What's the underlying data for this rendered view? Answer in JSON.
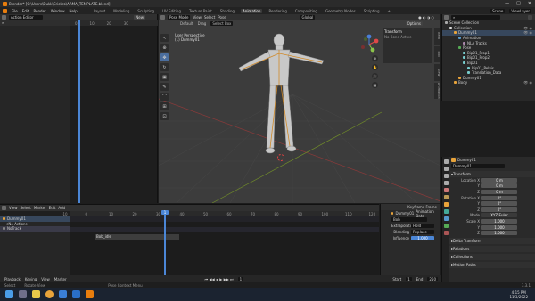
{
  "window": {
    "title": "Blender* [C:\\Users\\Dukk\\Erickro\\ARMA_TEMPLATE.blend]",
    "controls": [
      "—",
      "□",
      "✕"
    ]
  },
  "menubar": {
    "menus": [
      "File",
      "Edit",
      "Render",
      "Window",
      "Help"
    ],
    "workspaces": [
      "Layout",
      "Modeling",
      "Sculpting",
      "UV Editing",
      "Texture Paint",
      "Shading",
      "Animation",
      "Rendering",
      "Compositing",
      "Geometry Nodes",
      "Scripting",
      "+"
    ],
    "active_workspace": "Animation",
    "scene": "Scene",
    "view_layer": "ViewLayer"
  },
  "action_editor": {
    "mode": "Action Editor",
    "new_button": "New",
    "ruler": [
      "0",
      "10",
      "20",
      "30"
    ]
  },
  "viewport": {
    "mode": "Pose Mode",
    "menus": [
      "View",
      "Select",
      "Pose"
    ],
    "orientation": "Global",
    "orientation_default": "Default",
    "drag": "Drag",
    "select_box": "Select Box",
    "options": "Options",
    "info_line1": "User Perspective",
    "info_line2": "(1) Dummy01",
    "tool_icons": [
      "↖",
      "⊕",
      "✥",
      "↻",
      "▣",
      "✎",
      "⌒",
      "⊞",
      "⊡"
    ],
    "n_panel_title": "Transform",
    "n_panel_text": "No Bone Active",
    "side_tabs": [
      "Item",
      "Tool",
      "View",
      "Animation"
    ],
    "gizmo_axes": [
      "X",
      "Y",
      "Z"
    ],
    "nav_buttons": [
      "⊕",
      "✋",
      "🎥",
      "▦"
    ]
  },
  "outliner": {
    "search": "",
    "rows": [
      {
        "label": "Scene Collection",
        "indent": 0
      },
      {
        "label": "Collection",
        "indent": 1
      },
      {
        "label": "Dummy01",
        "indent": 2,
        "selected": true
      },
      {
        "label": "Animation",
        "indent": 3
      },
      {
        "label": "NLA Tracks",
        "indent": 4
      },
      {
        "label": "Pose",
        "indent": 3
      },
      {
        "label": "Bip01_Prop1",
        "indent": 4
      },
      {
        "label": "Bip01_Prop2",
        "indent": 4
      },
      {
        "label": "Bip01",
        "indent": 4
      },
      {
        "label": "Bip01_Pelvis",
        "indent": 5
      },
      {
        "label": "Translation_Data",
        "indent": 5
      },
      {
        "label": "Dummy01",
        "indent": 3
      },
      {
        "label": "Body",
        "indent": 2
      }
    ]
  },
  "properties": {
    "object_name": "Dummy01",
    "data_name": "Dummy01",
    "transform_title": "Transform",
    "location": {
      "label": "Location X",
      "x": "0 m",
      "y": "0 m",
      "z": "0 m"
    },
    "rotation": {
      "label": "Rotation X",
      "x": "0°",
      "y": "0°",
      "z": "0°"
    },
    "mode_label": "Mode",
    "mode": "XYZ Euler",
    "scale": {
      "label": "Scale X",
      "x": "1.000",
      "y": "1.000",
      "z": "1.000"
    },
    "sections": [
      "Delta Transform",
      "Relations",
      "Collections",
      "Motion Paths"
    ]
  },
  "timeline": {
    "menus": [
      "View",
      "Select",
      "Marker",
      "Edit",
      "Add"
    ],
    "ruler": [
      "-10",
      "0",
      "10",
      "20",
      "30",
      "40",
      "50",
      "60",
      "70",
      "80",
      "90",
      "100",
      "110",
      "120"
    ],
    "channels": [
      "Dummy01",
      "<No Action>",
      "NoTrack"
    ],
    "strip_label": "Bob_idle",
    "playhead_frame": "1"
  },
  "strip_props": {
    "title": "Dummy01",
    "subtitle": "Animation Data",
    "action_label": "Bob",
    "extrapolation_label": "Extrapolation",
    "extrapolation": "Hold",
    "blending_label": "Blending",
    "blending": "Replace",
    "influence_label": "Influence",
    "influence": "1.000",
    "keyframe": "Keyframe Frame"
  },
  "playback": {
    "items": [
      "Playback",
      "Keying",
      "View",
      "Marker"
    ],
    "frame": "1",
    "start_label": "Start",
    "start": "1",
    "end_label": "End",
    "end": "250"
  },
  "statusbar": {
    "left": "Select",
    "mid": "Rotate View",
    "right": "Pose Context Menu",
    "version": "3.3.1"
  },
  "taskbar": {
    "time": "4:15 PM",
    "date": "11/3/2022"
  }
}
